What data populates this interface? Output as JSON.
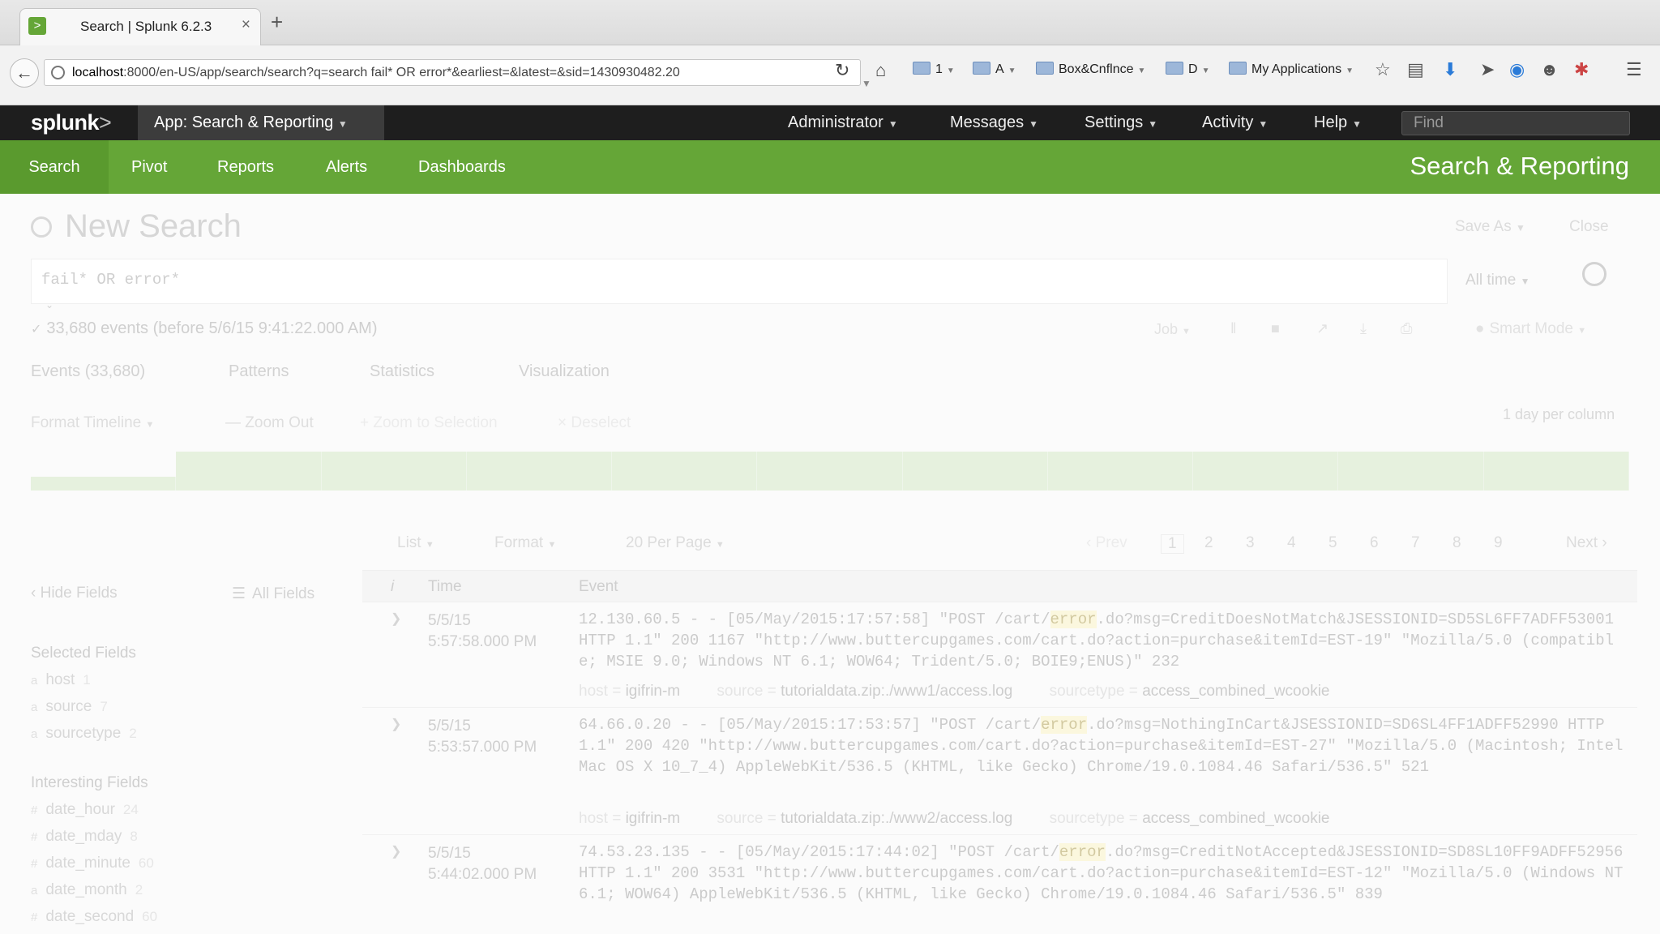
{
  "browser": {
    "tab_title": "Search | Splunk 6.2.3",
    "tab_close": "×",
    "new_tab": "+",
    "url_host": "localhost",
    "url_rest": ":8000/en-US/app/search/search?q=search fail* OR error*&earliest=&latest=&sid=1430930482.20",
    "bookmarks": [
      {
        "label": "1"
      },
      {
        "label": "A"
      },
      {
        "label": "Box&Cnflnce"
      },
      {
        "label": "D"
      },
      {
        "label": "My Applications"
      }
    ]
  },
  "splunk_bar": {
    "logo_text": "splunk",
    "logo_mark": ">",
    "app_menu": "App: Search & Reporting",
    "menus": [
      "Administrator",
      "Messages",
      "Settings",
      "Activity",
      "Help"
    ],
    "find_placeholder": "Find"
  },
  "app_bar": {
    "nav": [
      "Search",
      "Pivot",
      "Reports",
      "Alerts",
      "Dashboards"
    ],
    "title": "Search & Reporting"
  },
  "search": {
    "page_title": "New Search",
    "save_as": "Save As",
    "close": "Close",
    "query": "fail* OR error*",
    "time_range": "All time",
    "event_count": "33,680 events (before 5/6/15 9:41:22.000 AM)",
    "job_menu": "Job",
    "mode": "Smart Mode"
  },
  "results_tabs": [
    "Events (33,680)",
    "Patterns",
    "Statistics",
    "Visualization"
  ],
  "timeline": {
    "format": "Format Timeline",
    "zoom_out": "— Zoom Out",
    "zoom_selection": "+ Zoom to Selection",
    "deselect": "× Deselect",
    "scale": "1 day per column",
    "levels": [
      0.35,
      1.0,
      1.0,
      1.0,
      1.0,
      1.0,
      1.0,
      1.0,
      1.0,
      1.0,
      1.0
    ]
  },
  "event_controls": {
    "list": "List",
    "format": "Format",
    "per_page": "20 Per Page",
    "prev": "‹ Prev",
    "pages": [
      "1",
      "2",
      "3",
      "4",
      "5",
      "6",
      "7",
      "8",
      "9"
    ],
    "next": "Next ›"
  },
  "sidebar": {
    "hide_fields": "‹ Hide Fields",
    "all_fields": "All Fields",
    "selected_heading": "Selected Fields",
    "selected": [
      {
        "type": "a",
        "name": "host",
        "count": "1"
      },
      {
        "type": "a",
        "name": "source",
        "count": "7"
      },
      {
        "type": "a",
        "name": "sourcetype",
        "count": "2"
      }
    ],
    "interesting_heading": "Interesting Fields",
    "interesting": [
      {
        "type": "#",
        "name": "date_hour",
        "count": "24"
      },
      {
        "type": "#",
        "name": "date_mday",
        "count": "8"
      },
      {
        "type": "#",
        "name": "date_minute",
        "count": "60"
      },
      {
        "type": "a",
        "name": "date_month",
        "count": "2"
      },
      {
        "type": "#",
        "name": "date_second",
        "count": "60"
      }
    ]
  },
  "results": {
    "col_info": "i",
    "col_time": "Time",
    "col_event": "Event",
    "events": [
      {
        "date": "5/5/15",
        "time": "5:57:58.000 PM",
        "raw_pre": "12.130.60.5 - - [05/May/2015:17:57:58] \"POST /cart/",
        "raw_hl": "error",
        "raw_post": ".do?msg=CreditDoesNotMatch&JSESSIONID=SD5SL6FF7ADFF53001 HTTP 1.1\" 200 1167 \"http://www.buttercupgames.com/cart.do?action=purchase&itemId=EST-19\" \"Mozilla/5.0 (compatible; MSIE 9.0; Windows NT 6.1; WOW64; Trident/5.0; BOIE9;ENUS)\" 232",
        "host": "igifrin-m",
        "source": "tutorialdata.zip:./www1/access.log",
        "sourcetype": "access_combined_wcookie"
      },
      {
        "date": "5/5/15",
        "time": "5:53:57.000 PM",
        "raw_pre": "64.66.0.20 - - [05/May/2015:17:53:57] \"POST /cart/",
        "raw_hl": "error",
        "raw_post": ".do?msg=NothingInCart&JSESSIONID=SD6SL4FF1ADFF52990 HTTP 1.1\" 200 420 \"http://www.buttercupgames.com/cart.do?action=purchase&itemId=EST-27\" \"Mozilla/5.0 (Macintosh; Intel Mac OS X 10_7_4) AppleWebKit/536.5 (KHTML, like Gecko) Chrome/19.0.1084.46 Safari/536.5\" 521",
        "host": "igifrin-m",
        "source": "tutorialdata.zip:./www2/access.log",
        "sourcetype": "access_combined_wcookie"
      },
      {
        "date": "5/5/15",
        "time": "5:44:02.000 PM",
        "raw_pre": "74.53.23.135 - - [05/May/2015:17:44:02] \"POST /cart/",
        "raw_hl": "error",
        "raw_post": ".do?msg=CreditNotAccepted&JSESSIONID=SD8SL10FF9ADFF52956 HTTP 1.1\" 200 3531 \"http://www.buttercupgames.com/cart.do?action=purchase&itemId=EST-12\" \"Mozilla/5.0 (Windows NT 6.1; WOW64) AppleWebKit/536.5 (KHTML, like Gecko) Chrome/19.0.1084.46 Safari/536.5\" 839"
      }
    ],
    "meta_labels": {
      "host": "host =",
      "source": "source =",
      "sourcetype": "sourcetype ="
    }
  },
  "colors": {
    "splunk_green": "#65a637",
    "splunk_dark": "#1e1e1e"
  }
}
